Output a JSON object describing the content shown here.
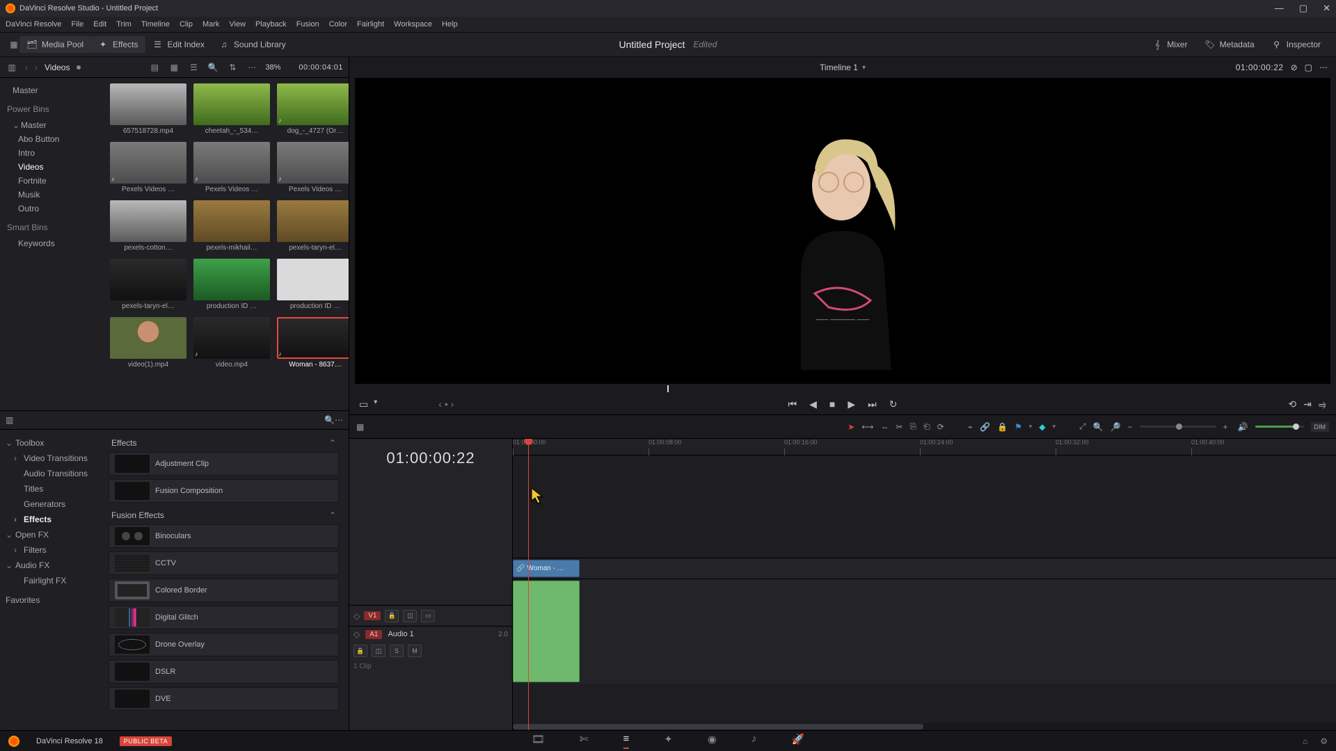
{
  "titlebar": {
    "text": "DaVinci Resolve Studio - Untitled Project"
  },
  "menubar": [
    "DaVinci Resolve",
    "File",
    "Edit",
    "Trim",
    "Timeline",
    "Clip",
    "Mark",
    "View",
    "Playback",
    "Fusion",
    "Color",
    "Fairlight",
    "Workspace",
    "Help"
  ],
  "toolstrip": {
    "media_pool": "Media Pool",
    "effects": "Effects",
    "edit_index": "Edit Index",
    "sound_library": "Sound Library",
    "project_title": "Untitled Project",
    "project_status": "Edited",
    "mixer": "Mixer",
    "metadata": "Metadata",
    "inspector": "Inspector"
  },
  "mp_bar": {
    "crumb": "Videos",
    "zoom": "38%",
    "source_tc": "00:00:04:01"
  },
  "bins": {
    "master": "Master",
    "power_header": "Power Bins",
    "power_master": "Master",
    "items": [
      "Abo Button",
      "Intro",
      "Videos",
      "Fortnite",
      "Musik",
      "Outro"
    ],
    "smart_header": "Smart Bins",
    "keywords": "Keywords"
  },
  "clips": [
    {
      "label": "657518728.mp4",
      "thumb": "road"
    },
    {
      "label": "cheetah_-_534…",
      "thumb": "grass"
    },
    {
      "label": "dog_-_4727 (Or…",
      "thumb": "grass",
      "audio": true
    },
    {
      "label": "Pexels Videos …",
      "thumb": "grey",
      "audio": true
    },
    {
      "label": "Pexels Videos …",
      "thumb": "grey",
      "audio": true
    },
    {
      "label": "Pexels Videos …",
      "thumb": "grey",
      "audio": true
    },
    {
      "label": "pexels-cotton…",
      "thumb": "road"
    },
    {
      "label": "pexels-mikhail…",
      "thumb": "forest"
    },
    {
      "label": "pexels-taryn-el…",
      "thumb": "forest"
    },
    {
      "label": "pexels-taryn-el…",
      "thumb": "dark"
    },
    {
      "label": "production ID …",
      "thumb": "green"
    },
    {
      "label": "production ID …",
      "thumb": "white"
    },
    {
      "label": "video(1).mp4",
      "thumb": "face"
    },
    {
      "label": "video.mp4",
      "thumb": "dark",
      "audio": true
    },
    {
      "label": "Woman - 8637…",
      "thumb": "dark",
      "audio": true,
      "selected": true
    }
  ],
  "fx_tree": {
    "toolbox": "Toolbox",
    "items1": [
      "Video Transitions",
      "Audio Transitions",
      "Titles",
      "Generators",
      "Effects"
    ],
    "openfx": "Open FX",
    "filters": "Filters",
    "audiofx": "Audio FX",
    "fairlight": "Fairlight FX",
    "favorites": "Favorites"
  },
  "fx_list": {
    "sec1": "Effects",
    "sec1_items": [
      "Adjustment Clip",
      "Fusion Composition"
    ],
    "sec2": "Fusion Effects",
    "sec2_items": [
      {
        "name": "Binoculars",
        "sw": "binoc"
      },
      {
        "name": "CCTV",
        "sw": "cctv"
      },
      {
        "name": "Colored Border",
        "sw": "border"
      },
      {
        "name": "Digital Glitch",
        "sw": "glitch"
      },
      {
        "name": "Drone Overlay",
        "sw": "drone"
      },
      {
        "name": "DSLR",
        "sw": ""
      },
      {
        "name": "DVE",
        "sw": ""
      }
    ]
  },
  "viewer": {
    "timeline_name": "Timeline 1",
    "record_tc": "01:00:00:22"
  },
  "timeline": {
    "big_tc": "01:00:00:22",
    "ruler": [
      "01:00:00:00",
      "01:00:08:00",
      "01:00:16:00",
      "01:00:24:00",
      "01:00:32:00",
      "01:00:40:00"
    ],
    "v1": "V1",
    "a1": "A1",
    "a1_name": "Audio 1",
    "a1_ch": "2.0",
    "a1_clips": "1 Clip",
    "clip_name": "Woman - …",
    "solo": "S",
    "mute": "M",
    "dim": "DIM"
  },
  "pagebar": {
    "version": "DaVinci Resolve 18",
    "beta": "PUBLIC BETA"
  }
}
